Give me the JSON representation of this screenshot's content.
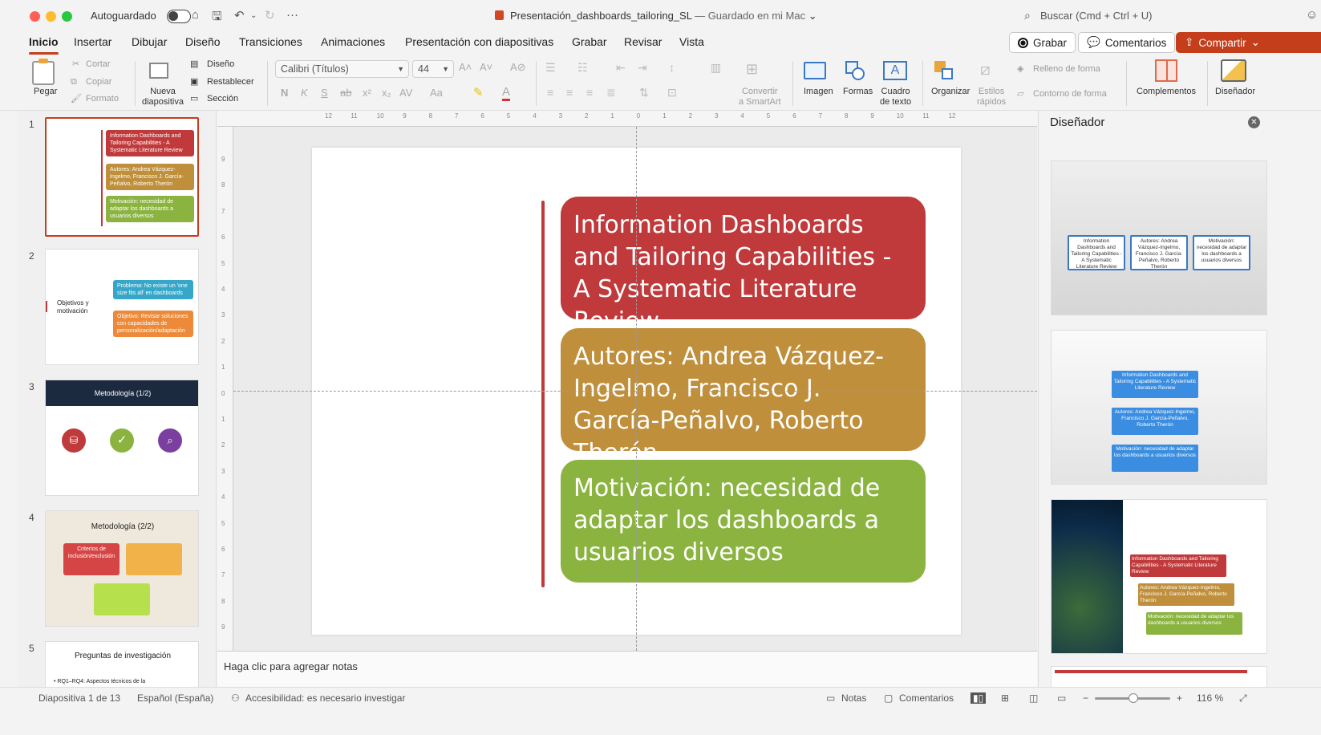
{
  "titlebar": {
    "autosave_label": "Autoguardado",
    "document_title": "Presentación_dashboards_tailoring_SL",
    "save_status": "— Guardado en mi Mac",
    "search_placeholder": "Buscar (Cmd + Ctrl + U)"
  },
  "tabs": [
    "Inicio",
    "Insertar",
    "Dibujar",
    "Diseño",
    "Transiciones",
    "Animaciones",
    "Presentación con diapositivas",
    "Grabar",
    "Revisar",
    "Vista"
  ],
  "actions": {
    "record": "Grabar",
    "comments": "Comentarios",
    "share": "Compartir"
  },
  "ribbon": {
    "paste": "Pegar",
    "cut": "Cortar",
    "copy": "Copiar",
    "format": "Formato",
    "new_slide": "Nueva\ndiapositiva",
    "layout": "Diseño",
    "reset": "Restablecer",
    "section": "Sección",
    "font_name": "Calibri (Títulos)",
    "font_size": "44",
    "convert_smartart": "Convertir\na SmartArt",
    "image": "Imagen",
    "shapes": "Formas",
    "textbox": "Cuadro\nde texto",
    "arrange": "Organizar",
    "quick_styles": "Estilos\nrápidos",
    "shape_fill": "Relleno de forma",
    "shape_outline": "Contorno de forma",
    "addins": "Complementos",
    "designer": "Diseñador"
  },
  "thumbnails": [
    {
      "num": "1",
      "boxes": [
        "Information Dashboards and Tailoring Capabilities - A Systematic Literature Review",
        "Autores: Andrea Vázquez-Ingelmo, Francisco J. García-Peñalvo, Roberto Therón",
        "Motivación: necesidad de adaptar los dashboards a usuarios diversos"
      ]
    },
    {
      "num": "2",
      "title": "Objetivos y motivación",
      "boxes": [
        "Problema: No existe un 'one size fits all' en dashboards",
        "Objetivo: Revisar soluciones con capacidades de personalización/adaptación"
      ]
    },
    {
      "num": "3",
      "title": "Metodología (1/2)"
    },
    {
      "num": "4",
      "title": "Metodología (2/2)",
      "boxes": [
        "Criterios de inclusión/exclusión"
      ]
    },
    {
      "num": "5",
      "title": "Preguntas de investigación",
      "bullet": "• RQ1–RQ4: Aspectos técnicos de la"
    }
  ],
  "slide": {
    "box1": "Information Dashboards and Tailoring Capabilities - A Systematic Literature Review",
    "box2": "Autores: Andrea Vázquez-Ingelmo, Francisco J. García-Peñalvo, Roberto Therón",
    "box3": "Motivación: necesidad de adaptar los dashboards a usuarios diversos",
    "colors": {
      "red": "#c0393b",
      "gold": "#bf8f3b",
      "green": "#8ab43f"
    }
  },
  "notes_placeholder": "Haga clic para agregar notas",
  "designer": {
    "title": "Diseñador",
    "card1": [
      "Information Dashboards and Tailoring Capabilities - A Systematic Literature Review",
      "Autores: Andrea Vázquez-Ingelmo, Francisco J. García-Peñalvo, Roberto Therón",
      "Motivación: necesidad de adaptar los dashboards a usuarios diversos"
    ],
    "card2": [
      "Information Dashboards and Tailoring Capabilities - A Systematic Literature Review",
      "Autores: Andrea Vázquez-Ingelmo, Francisco J. García-Peñalvo, Roberto Therón",
      "Motivación: necesidad de adaptar los dashboards a usuarios diversos"
    ],
    "card3": [
      "Information Dashboards and Tailoring Capabilities - A Systematic Literature Review",
      "Autores: Andrea Vázquez-Ingelmo, Francisco J. García-Peñalvo, Roberto Therón",
      "Motivación: necesidad de adaptar los dashboards a usuarios diversos"
    ]
  },
  "status": {
    "slide_count": "Diapositiva 1 de 13",
    "language": "Español (España)",
    "accessibility": "Accesibilidad: es necesario investigar",
    "notes": "Notas",
    "comments": "Comentarios",
    "zoom": "116 %"
  }
}
